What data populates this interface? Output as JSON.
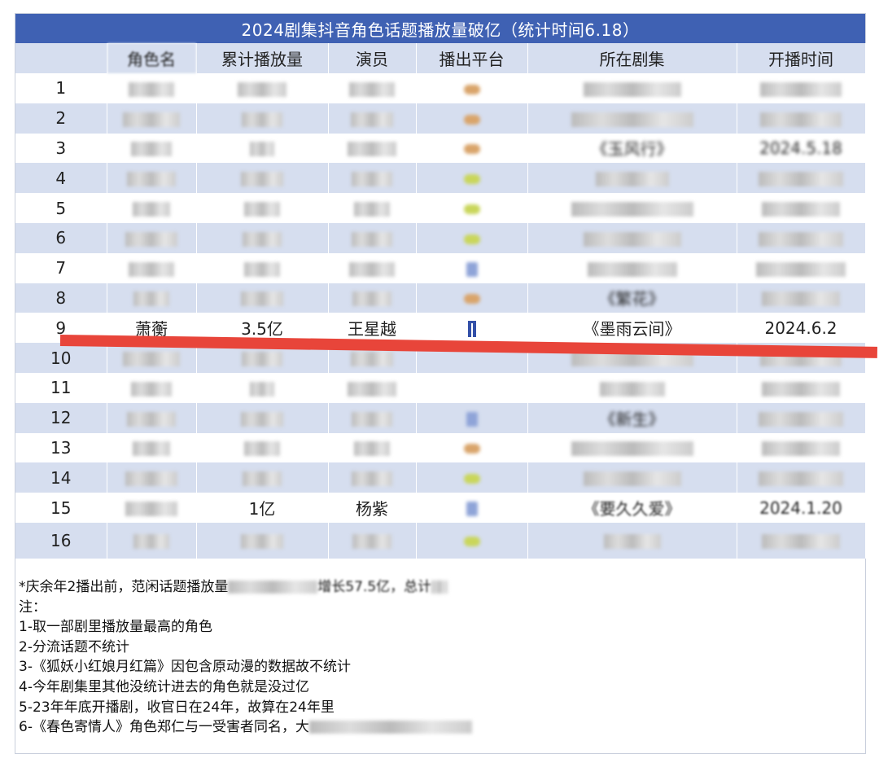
{
  "title": "2024剧集抖音角色话题播放量破亿（统计时间6.18）",
  "headers": [
    "",
    "角色名",
    "累计播放量",
    "演员",
    "播出平台",
    "所在剧集",
    "开播时间"
  ],
  "rows": [
    {
      "rank": "1",
      "role": "",
      "views": "",
      "actor": "",
      "platform": "orange",
      "drama": "",
      "date": "",
      "blurred": true
    },
    {
      "rank": "2",
      "role": "",
      "views": "",
      "actor": "",
      "platform": "orange",
      "drama": "",
      "date": "",
      "blurred": true
    },
    {
      "rank": "3",
      "role": "",
      "views": "",
      "actor": "",
      "platform": "orange",
      "drama": "《玉风行》",
      "date": "2024.5.18",
      "blurred": true
    },
    {
      "rank": "4",
      "role": "",
      "views": "",
      "actor": "",
      "platform": "green",
      "drama": "",
      "date": "",
      "blurred": true
    },
    {
      "rank": "5",
      "role": "",
      "views": "",
      "actor": "",
      "platform": "green",
      "drama": "",
      "date": "",
      "blurred": true
    },
    {
      "rank": "6",
      "role": "",
      "views": "",
      "actor": "",
      "platform": "green",
      "drama": "",
      "date": "",
      "blurred": true
    },
    {
      "rank": "7",
      "role": "",
      "views": "",
      "actor": "",
      "platform": "blue",
      "drama": "",
      "date": "",
      "blurred": true
    },
    {
      "rank": "8",
      "role": "",
      "views": "",
      "actor": "",
      "platform": "orange",
      "drama": "《繁花》",
      "date": "",
      "blurred": true
    },
    {
      "rank": "9",
      "role": "萧蘅",
      "views": "3.5亿",
      "actor": "王星越",
      "platform": "blue-bar",
      "drama": "《墨雨云间》",
      "date": "2024.6.2",
      "blurred": false
    },
    {
      "rank": "10",
      "role": "",
      "views": "",
      "actor": "",
      "platform": "",
      "drama": "",
      "date": "",
      "blurred": true
    },
    {
      "rank": "11",
      "role": "",
      "views": "",
      "actor": "",
      "platform": "",
      "drama": "",
      "date": "",
      "blurred": true
    },
    {
      "rank": "12",
      "role": "",
      "views": "",
      "actor": "",
      "platform": "blue",
      "drama": "《新生》",
      "date": "",
      "blurred": true
    },
    {
      "rank": "13",
      "role": "",
      "views": "",
      "actor": "",
      "platform": "orange",
      "drama": "",
      "date": "",
      "blurred": true
    },
    {
      "rank": "14",
      "role": "",
      "views": "",
      "actor": "",
      "platform": "green",
      "drama": "",
      "date": "",
      "blurred": true
    },
    {
      "rank": "15",
      "role": "",
      "views": "1亿",
      "actor": "杨紫",
      "platform": "blue",
      "drama": "《要久久爱》",
      "date": "2024.1.20",
      "blurred": "partial"
    },
    {
      "rank": "16",
      "role": "",
      "views": "",
      "actor": "",
      "platform": "green",
      "drama": "",
      "date": "",
      "blurred": true
    }
  ],
  "notes": {
    "footnote": "*庆余年2播出前，范闲话题播放量",
    "footnote_tail": "增长57.5亿，总计",
    "heading": "注：",
    "items": [
      "1-取一部剧里播放量最高的角色",
      "2-分流话题不统计",
      "3-《狐妖小红娘月红篇》因包含原动漫的数据故不统计",
      "4-今年剧集里其他没统计进去的角色就是没过亿",
      "5-23年年底开播剧，收官日在24年，故算在24年里",
      "6-《春色寄情人》角色郑仁与一受害者同名，大"
    ]
  },
  "colors": {
    "title_bg": "#3f61b3",
    "stripe": "#d6deef",
    "strike": "#e8453a",
    "platform_orange": "#d9a46a",
    "platform_green": "#c9d65a",
    "platform_blue": "#8fa4d8",
    "platform_bar": "#3350a8"
  }
}
